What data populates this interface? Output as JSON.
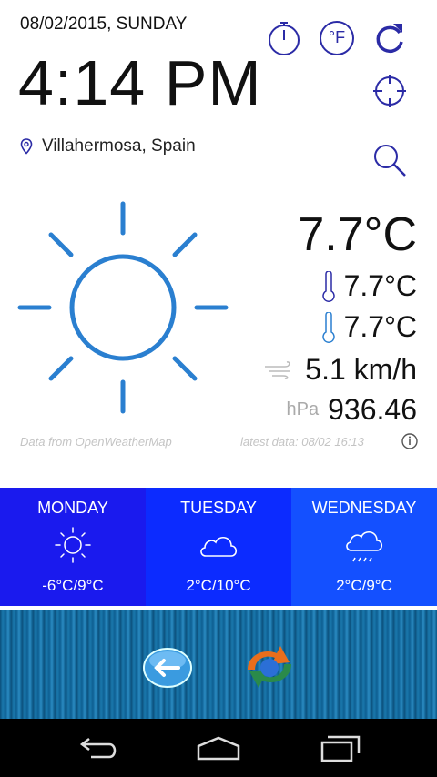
{
  "header": {
    "date": "08/02/2015, SUNDAY",
    "time": "4:14 PM",
    "location": "Villahermosa, Spain"
  },
  "toolbar": {
    "fahrenheit_label": "°F",
    "icons": [
      "timer-icon",
      "fahrenheit-icon",
      "refresh-icon",
      "locate-icon",
      "search-icon"
    ]
  },
  "current": {
    "temperature": "7.7°C",
    "temp_max": "7.7°C",
    "temp_min": "7.7°C",
    "wind": "5.1 km/h",
    "pressure_label": "hPa",
    "pressure": "936.46"
  },
  "notes": {
    "source": "Data from OpenWeatherMap",
    "latest": "latest data: 08/02 16:13"
  },
  "forecast": [
    {
      "day": "MONDAY",
      "temps": "-6°C/9°C",
      "icon": "sun-icon",
      "color": "#1a1aee"
    },
    {
      "day": "TUESDAY",
      "temps": "2°C/10°C",
      "icon": "cloud-icon",
      "color": "#0c2bff"
    },
    {
      "day": "WEDNESDAY",
      "temps": "2°C/9°C",
      "icon": "rain-cloud-icon",
      "color": "#1450ff"
    }
  ],
  "colors": {
    "accent": "#2b2ba6",
    "sun": "#2a7fd0"
  }
}
